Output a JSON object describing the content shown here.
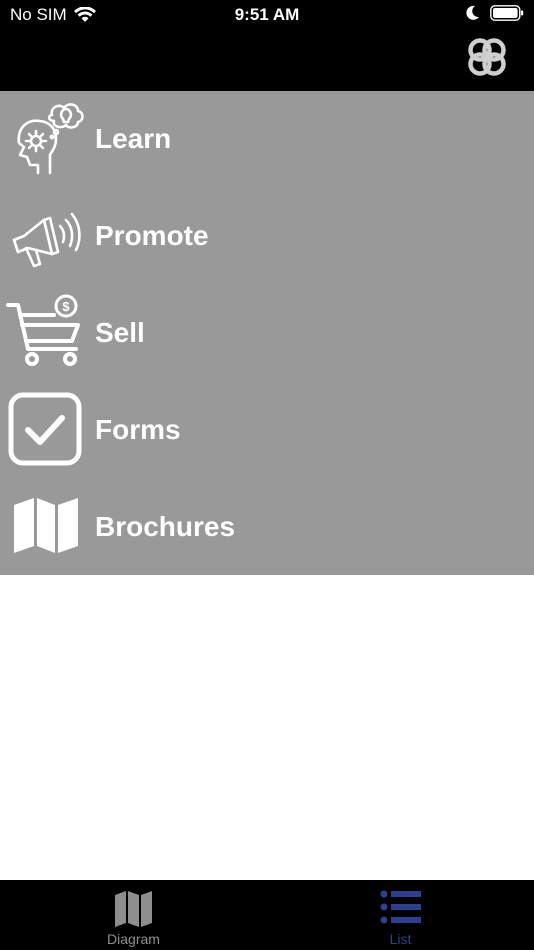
{
  "status_bar": {
    "carrier": "No SIM",
    "time": "9:51 AM"
  },
  "menu": {
    "items": [
      {
        "label": "Learn",
        "icon": "head-gears-lightbulb-icon"
      },
      {
        "label": "Promote",
        "icon": "megaphone-icon"
      },
      {
        "label": "Sell",
        "icon": "shopping-cart-dollar-icon"
      },
      {
        "label": "Forms",
        "icon": "checkbox-icon"
      },
      {
        "label": "Brochures",
        "icon": "map-icon"
      }
    ]
  },
  "tab_bar": {
    "tabs": [
      {
        "label": "Diagram",
        "icon": "map-icon",
        "selected": false
      },
      {
        "label": "List",
        "icon": "list-icon",
        "selected": true
      }
    ]
  },
  "colors": {
    "menu_background": "#999999",
    "bar_background": "#000000",
    "tab_active": "#2f3f8f",
    "tab_inactive": "#8e8e8e"
  }
}
